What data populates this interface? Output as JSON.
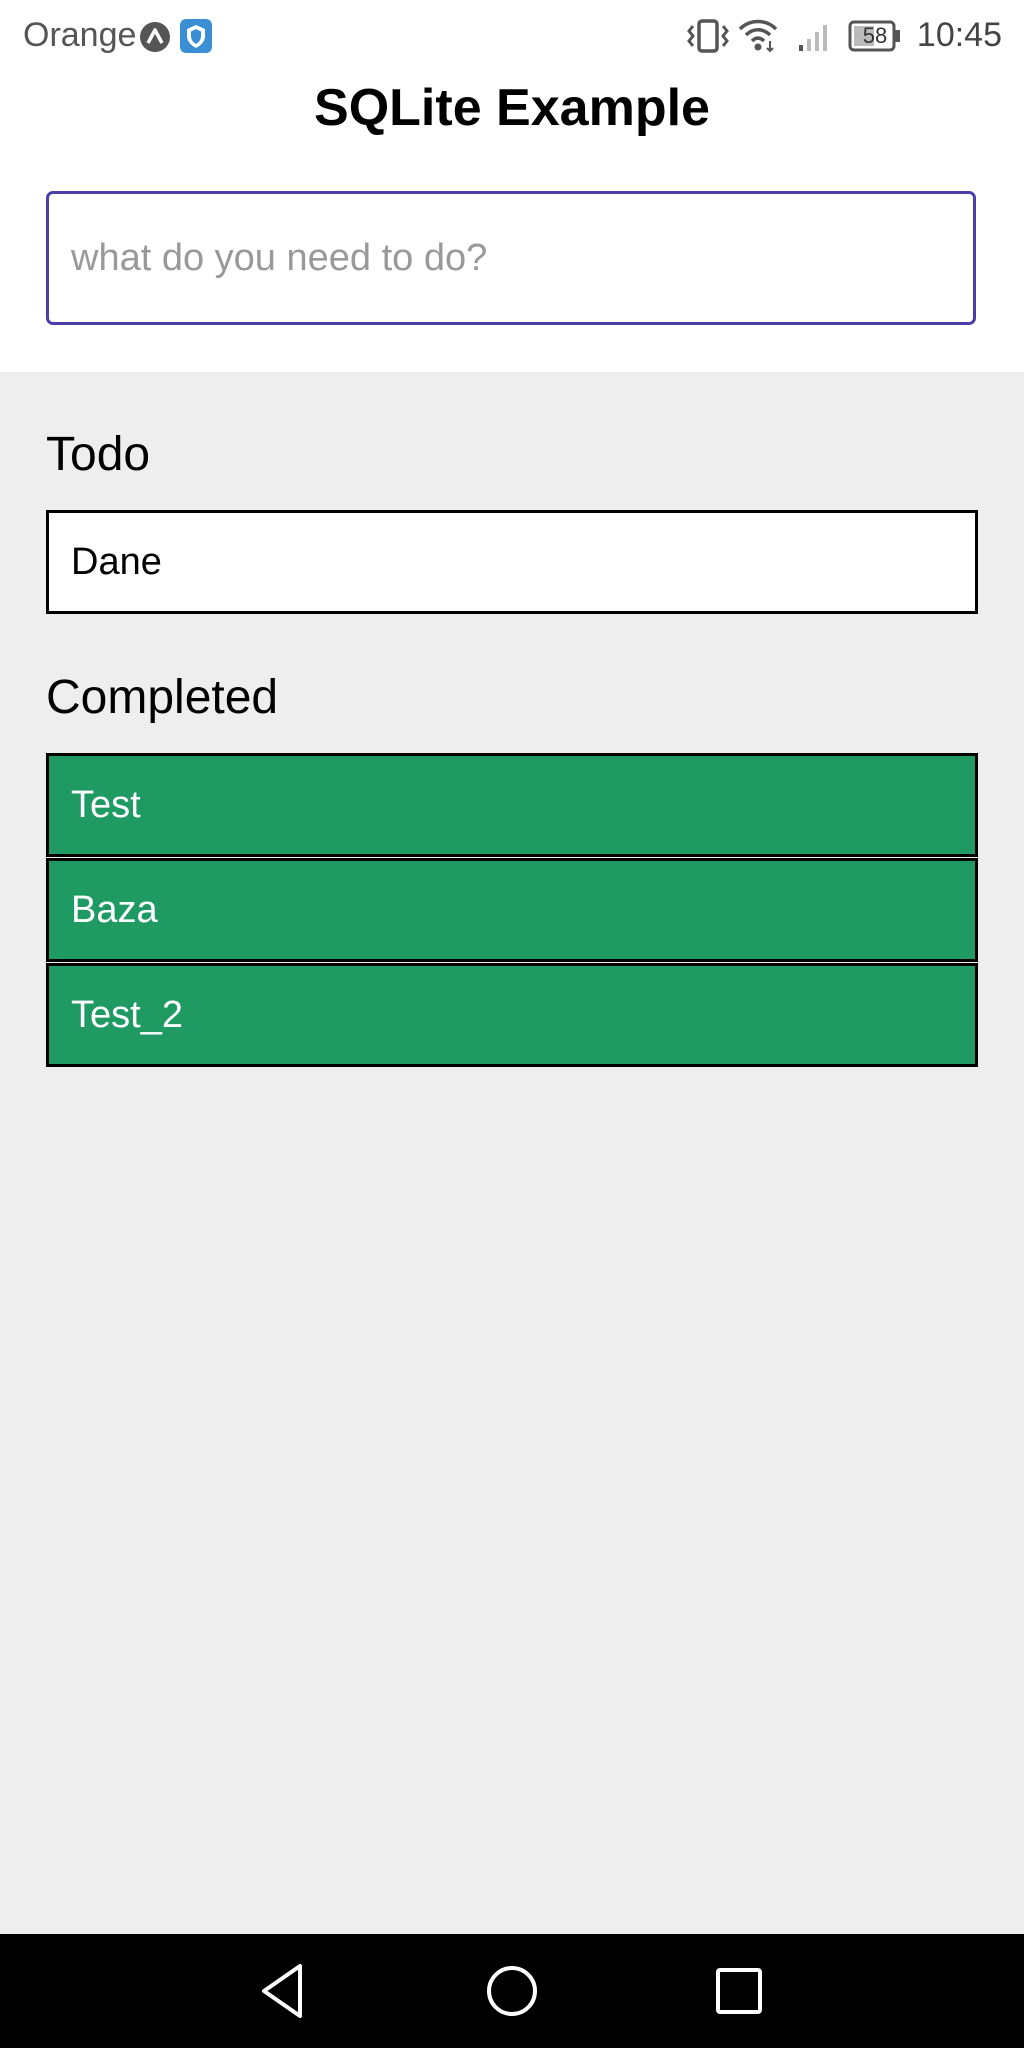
{
  "status_bar": {
    "carrier": "Orange",
    "battery": "58",
    "time": "10:45",
    "icons": [
      "app-badge-icon",
      "shield-icon",
      "vibrate-icon",
      "wifi-icon",
      "signal-icon",
      "battery-icon"
    ]
  },
  "header": {
    "title": "SQLite Example"
  },
  "new_todo": {
    "placeholder": "what do you need to do?",
    "value": ""
  },
  "todo_section": {
    "heading": "Todo",
    "items": [
      {
        "label": "Dane"
      }
    ]
  },
  "completed_section": {
    "heading": "Completed",
    "items": [
      {
        "label": "Test"
      },
      {
        "label": "Baza"
      },
      {
        "label": "Test_2"
      }
    ]
  },
  "nav_bar": {
    "buttons": [
      "back-icon",
      "home-icon",
      "recents-icon"
    ]
  },
  "colors": {
    "completed_bg": "#1f9a62",
    "input_border": "#4a3fa8",
    "list_bg": "#eeeeee"
  }
}
